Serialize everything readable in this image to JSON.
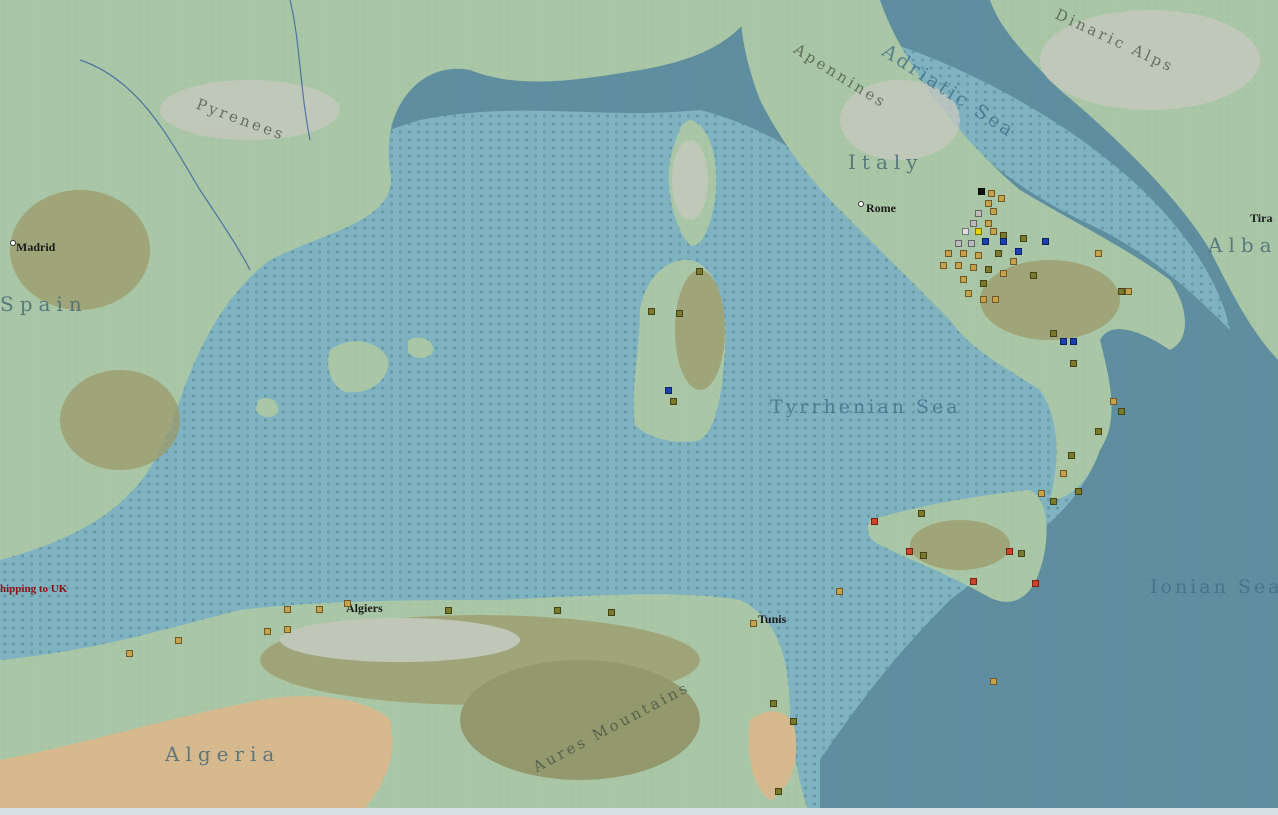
{
  "map": {
    "regions": {
      "italy": "Italy",
      "spain": "Spain",
      "algeria": "Algeria",
      "albania": "Alban"
    },
    "seas": {
      "tyrrhenian": "Tyrrhenian Sea",
      "adriatic": "Adriatic Sea",
      "ionian": "Ionian Sea"
    },
    "cities": {
      "rome": "Rome",
      "madrid": "Madrid",
      "algiers": "Algiers",
      "tunis": "Tunis",
      "tirana": "Tira"
    },
    "mountains": {
      "pyrenees": "Pyrenees",
      "apennines": "Apennines",
      "atlas": "Aures Mountains",
      "dinaric": "Dinaric Alps"
    },
    "annotations": {
      "shipping": "hipping to UK"
    },
    "colors": {
      "sea_deep": "#5f8ea0",
      "sea_shallow": "#7fb3c2",
      "land": "#a9c7a6",
      "desert": "#d8b98e",
      "unit_axis_tan": "#c8a24a",
      "unit_axis_olive": "#7a7a2a",
      "unit_allied_blue": "#1a3fb0",
      "unit_french_red": "#d0432a"
    }
  }
}
